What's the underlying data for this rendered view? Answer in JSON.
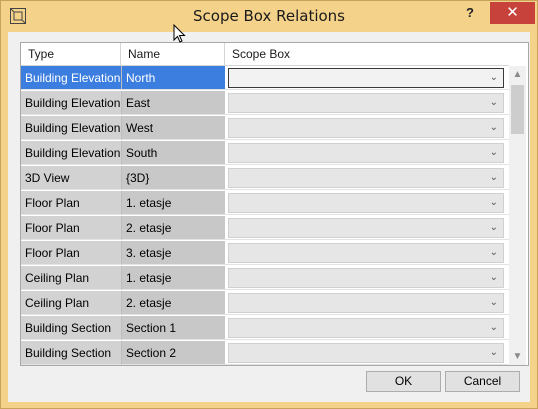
{
  "window": {
    "title": "Scope Box Relations",
    "help_label": "?",
    "close_label": "✕",
    "title_bar_color": "#f5d28a"
  },
  "grid": {
    "columns": [
      "Type",
      "Name",
      "Scope Box"
    ],
    "rows": [
      {
        "type": "Building Elevation",
        "name": "North",
        "scope_box": ""
      },
      {
        "type": "Building Elevation",
        "name": "East",
        "scope_box": ""
      },
      {
        "type": "Building Elevation",
        "name": "West",
        "scope_box": ""
      },
      {
        "type": "Building Elevation",
        "name": "South",
        "scope_box": ""
      },
      {
        "type": "3D View",
        "name": "{3D}",
        "scope_box": ""
      },
      {
        "type": "Floor Plan",
        "name": "1. etasje",
        "scope_box": ""
      },
      {
        "type": "Floor Plan",
        "name": "2. etasje",
        "scope_box": ""
      },
      {
        "type": "Floor Plan",
        "name": "3. etasje",
        "scope_box": ""
      },
      {
        "type": "Ceiling Plan",
        "name": "1. etasje",
        "scope_box": ""
      },
      {
        "type": "Ceiling Plan",
        "name": "2. etasje",
        "scope_box": ""
      },
      {
        "type": "Building Section",
        "name": "Section 1",
        "scope_box": ""
      },
      {
        "type": "Building Section",
        "name": "Section 2",
        "scope_box": ""
      }
    ],
    "selected_row": 0,
    "selection_color": "#3c7ee0"
  },
  "buttons": {
    "ok": "OK",
    "cancel": "Cancel"
  }
}
